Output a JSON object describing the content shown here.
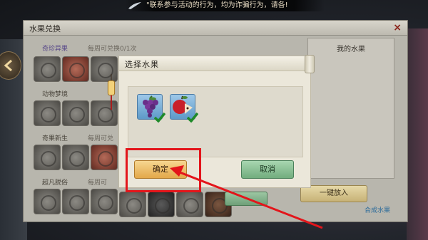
{
  "notice": {
    "text": "\"联系参与活动的行为，均为诈骗行为，请各!",
    "icon": "feather-icon"
  },
  "panel": {
    "title": "水果兑换",
    "close_icon": "×",
    "sections": [
      {
        "label": "奇珍异果",
        "sub": "每周可兑换0/1次"
      },
      {
        "label": "动物梦境",
        "sub": ""
      },
      {
        "label": "奇果新生",
        "sub": "每周可兑"
      },
      {
        "label": "超凡脱俗",
        "sub": "每周可"
      }
    ],
    "right_title": "我的水果",
    "put_in_button": "一键放入",
    "synth_link": "合成水果"
  },
  "dialog": {
    "title": "选择水果",
    "fruits": [
      {
        "name": "grape",
        "icon": "grape-icon",
        "selected": true
      },
      {
        "name": "apple",
        "icon": "apple-icon",
        "selected": true
      }
    ],
    "confirm_label": "确定",
    "cancel_label": "取消"
  },
  "colors": {
    "highlight": "#e3151b",
    "confirm": "#e3a84a",
    "cancel": "#72ad7e"
  }
}
